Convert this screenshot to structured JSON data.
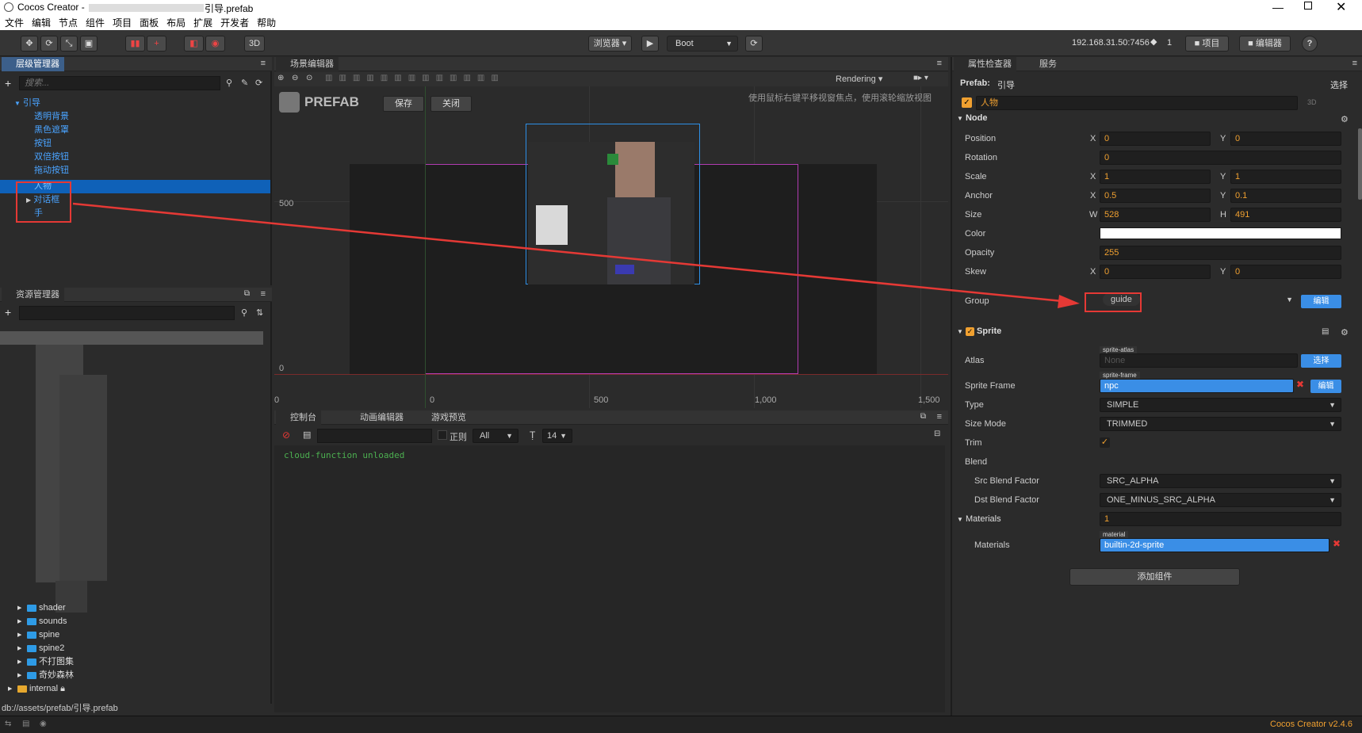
{
  "window": {
    "title": "Cocos Creator - ",
    "file_title": "引导.prefab"
  },
  "menu": [
    "文件",
    "编辑",
    "节点",
    "组件",
    "项目",
    "面板",
    "布局",
    "扩展",
    "开发者",
    "帮助"
  ],
  "toolbar": {
    "view3d": "3D",
    "browser": "浏览器",
    "scene": "Boot",
    "ip": "192.168.31.50:7456",
    "conn": "1",
    "project_btn": "项目",
    "editor_btn": "编辑器",
    "help": "?"
  },
  "hierarchy": {
    "tab": "层级管理器",
    "search_placeholder": "搜索...",
    "root": "引导",
    "items": [
      "透明背景",
      "黑色遮罩",
      "按钮",
      "双倍按钮",
      "拖动按钮",
      "人物",
      "对话框",
      "手"
    ]
  },
  "assets": {
    "tab": "资源管理器",
    "folders": [
      "shader",
      "sounds",
      "spine",
      "spine2",
      "不打图集",
      "奇妙森林"
    ],
    "internal": "internal",
    "path": "db://assets/prefab/引导.prefab"
  },
  "scene": {
    "tab": "场景编辑器",
    "rendering": "Rendering",
    "prefab_label": "PREFAB",
    "save": "保存",
    "close": "关闭",
    "hint": "使用鼠标右键平移视窗焦点，使用滚轮缩放视图",
    "y_labels": [
      "500",
      "0"
    ],
    "x_labels": [
      "0",
      "0",
      "500",
      "1,000",
      "1,500"
    ]
  },
  "console": {
    "tabs": [
      "控制台",
      "动画编辑器",
      "游戏预览"
    ],
    "regex": "正则",
    "filter": "All",
    "font_size": "14",
    "log": "cloud-function unloaded"
  },
  "inspector": {
    "tabs": [
      "属性检查器",
      "服务"
    ],
    "prefab_label": "Prefab:",
    "prefab_name": "引导",
    "select": "选择",
    "node_name": "人物",
    "mode": "3D",
    "node": {
      "section": "Node",
      "position": {
        "x": "0",
        "y": "0"
      },
      "rotation": "0",
      "scale": {
        "x": "1",
        "y": "1"
      },
      "anchor": {
        "x": "0.5",
        "y": "0.1"
      },
      "size": {
        "w": "528",
        "h": "491"
      },
      "opacity": "255",
      "skew": {
        "x": "0",
        "y": "0"
      },
      "group": "guide",
      "edit": "编辑",
      "labels": {
        "position": "Position",
        "rotation": "Rotation",
        "scale": "Scale",
        "anchor": "Anchor",
        "size": "Size",
        "color": "Color",
        "opacity": "Opacity",
        "skew": "Skew",
        "group": "Group"
      }
    },
    "sprite": {
      "section": "Sprite",
      "atlas_label": "Atlas",
      "atlas_tag": "sprite-atlas",
      "atlas_value": "None",
      "frame_label": "Sprite Frame",
      "frame_tag": "sprite-frame",
      "frame_value": "npc",
      "type_label": "Type",
      "type": "SIMPLE",
      "sizemode_label": "Size Mode",
      "sizemode": "TRIMMED",
      "trim_label": "Trim",
      "blend_label": "Blend",
      "src_label": "Src Blend Factor",
      "src": "SRC_ALPHA",
      "dst_label": "Dst Blend Factor",
      "dst": "ONE_MINUS_SRC_ALPHA",
      "materials_label": "Materials",
      "materials_count": "1",
      "materials_item_label": "Materials",
      "material_tag": "material",
      "material_value": "builtin-2d-sprite"
    },
    "add_component": "添加组件"
  },
  "status": {
    "version": "Cocos Creator v2.4.6"
  },
  "colors": {
    "accent": "#3a8ee6",
    "highlight": "#e53935",
    "value": "#f0a030"
  }
}
